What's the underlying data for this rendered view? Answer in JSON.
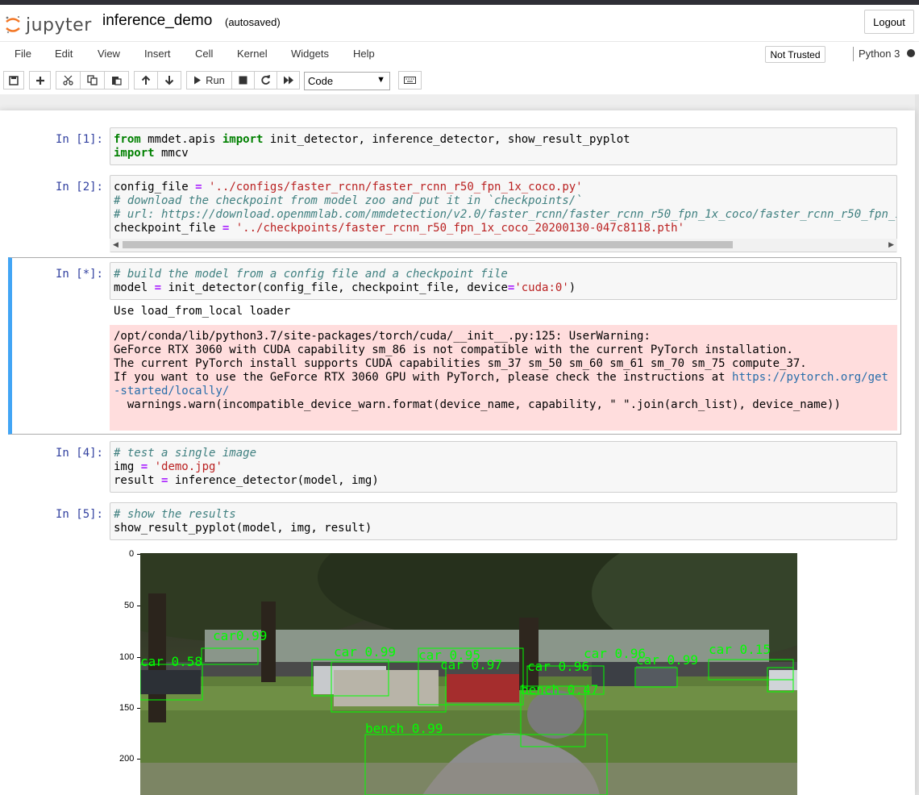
{
  "header": {
    "logo_text": "jupyter",
    "notebook_name": "inference_demo",
    "autosave_status": "(autosaved)",
    "logout_label": "Logout"
  },
  "menubar": {
    "items": [
      "File",
      "Edit",
      "View",
      "Insert",
      "Cell",
      "Kernel",
      "Widgets",
      "Help"
    ],
    "trust_label": "Not Trusted",
    "kernel_name": "Python 3"
  },
  "toolbar": {
    "run_label": "Run",
    "cell_type": "Code",
    "icons": [
      "save-icon",
      "plus-icon",
      "cut-icon",
      "copy-icon",
      "paste-icon",
      "arrow-up-icon",
      "arrow-down-icon",
      "run-icon",
      "stop-icon",
      "restart-icon",
      "fast-forward-icon",
      "keyboard-icon"
    ]
  },
  "cells": [
    {
      "prompt": "In [1]:",
      "lines": [
        "from mmdet.apis import init_detector, inference_detector, show_result_pyplot",
        "import mmcv"
      ]
    },
    {
      "prompt": "In [2]:",
      "lines": [
        "config_file = '../configs/faster_rcnn/faster_rcnn_r50_fpn_1x_coco.py'",
        "# download the checkpoint from model zoo and put it in `checkpoints/`",
        "# url: https://download.openmmlab.com/mmdetection/v2.0/faster_rcnn/faster_rcnn_r50_fpn_1x_coco/faster_rcnn_r50_fpn_1",
        "checkpoint_file = '../checkpoints/faster_rcnn_r50_fpn_1x_coco_20200130-047c8118.pth'"
      ]
    },
    {
      "prompt": "In [*]:",
      "lines": [
        "# build the model from a config file and a checkpoint file",
        "model = init_detector(config_file, checkpoint_file, device='cuda:0')"
      ],
      "output": "Use load_from_local loader",
      "stderr": [
        "/opt/conda/lib/python3.7/site-packages/torch/cuda/__init__.py:125: UserWarning:",
        "GeForce RTX 3060 with CUDA capability sm_86 is not compatible with the current PyTorch installation.",
        "The current PyTorch install supports CUDA capabilities sm_37 sm_50 sm_60 sm_61 sm_70 sm_75 compute_37.",
        "If you want to use the GeForce RTX 3060 GPU with PyTorch, please check the instructions at https://pytorch.org/get",
        "-started/locally/",
        "",
        "  warnings.warn(incompatible_device_warn.format(device_name, capability, \" \".join(arch_list), device_name))"
      ]
    },
    {
      "prompt": "In [4]:",
      "lines": [
        "# test a single image",
        "img = 'demo.jpg'",
        "result = inference_detector(model, img)"
      ]
    },
    {
      "prompt": "In [5]:",
      "lines": [
        "# show the results",
        "show_result_pyplot(model, img, result)"
      ]
    }
  ],
  "figure": {
    "y_ticks": [
      "0",
      "50",
      "100",
      "150",
      "200"
    ],
    "detection_labels": [
      "car 0.58",
      "car 0.96",
      "car 0.99",
      "car 0.95",
      "car 0.97",
      "bench 0.99",
      "car 0.15",
      "bench 0.47"
    ]
  },
  "colors": {
    "prompt": "#303f9f",
    "keyword": "#008000",
    "string": "#ba2121",
    "comment": "#408080",
    "stderr_bg": "#ffdddd",
    "selected_border": "#42a5f5",
    "detection_box": "#00ff00"
  }
}
